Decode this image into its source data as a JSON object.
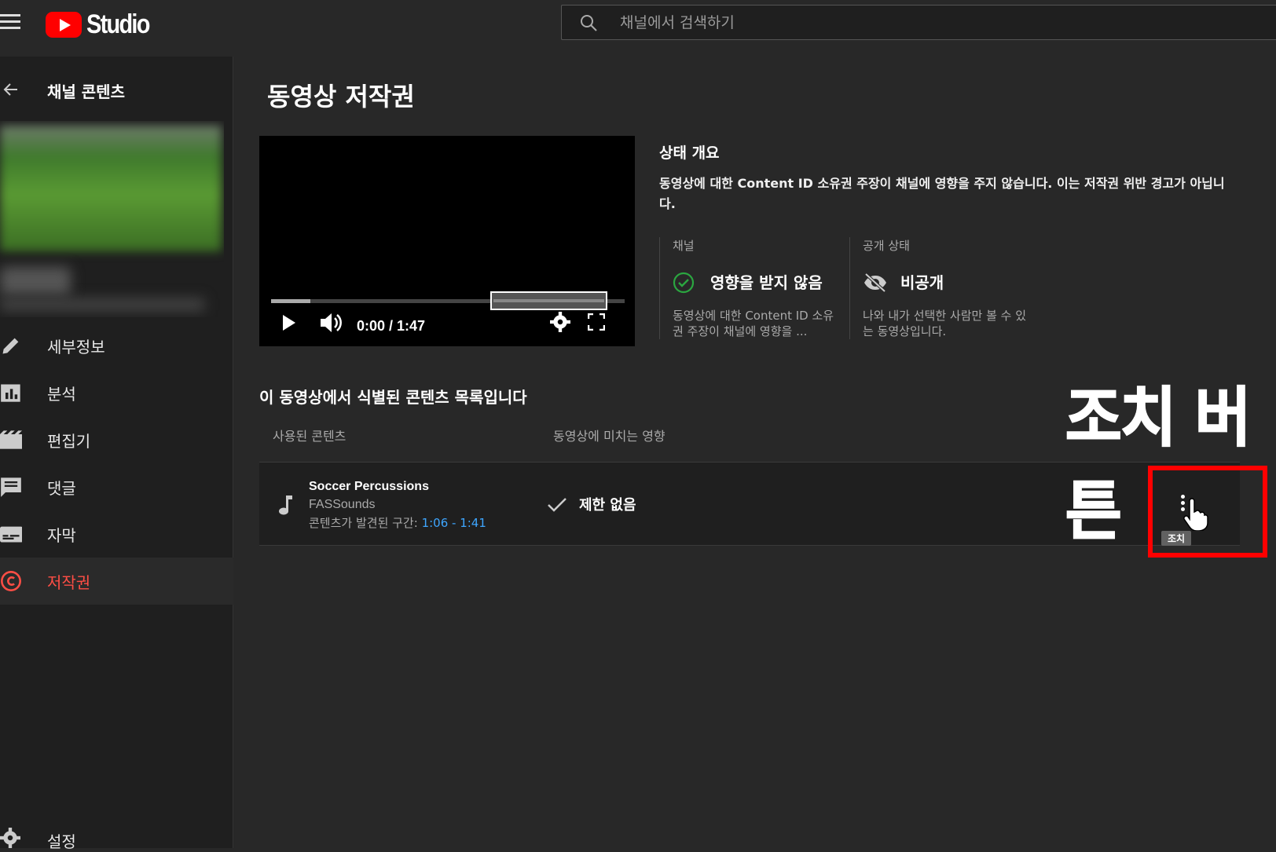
{
  "header": {
    "logo_text": "Studio",
    "search_placeholder": "채널에서 검색하기"
  },
  "sidebar": {
    "back_label": "채널 콘텐츠",
    "items": [
      {
        "label": "세부정보",
        "icon": "pencil-icon"
      },
      {
        "label": "분석",
        "icon": "analytics-icon"
      },
      {
        "label": "편집기",
        "icon": "editor-icon"
      },
      {
        "label": "댓글",
        "icon": "comments-icon"
      },
      {
        "label": "자막",
        "icon": "subtitles-icon"
      },
      {
        "label": "저작권",
        "icon": "copyright-icon",
        "active": true
      }
    ],
    "settings_label": "설정"
  },
  "main": {
    "title": "동영상 저작권",
    "player": {
      "time": "0:00 / 1:47",
      "played_fraction": 0.11,
      "segment_start_fraction": 0.62,
      "segment_end_fraction": 0.95
    },
    "status": {
      "heading": "상태 개요",
      "description": "동영상에 대한 Content ID 소유권 주장이 채널에 영향을 주지 않습니다. 이는 저작권 위반 경고가 아닙니다.",
      "channel": {
        "label": "채널",
        "value": "영향을 받지 않음",
        "detail": "동영상에 대한 Content ID 소유권 주장이 채널에 영향을 ..."
      },
      "visibility": {
        "label": "공개 상태",
        "value": "비공개",
        "detail": "나와 내가 선택한 사람만 볼 수 있는 동영상입니다."
      }
    },
    "list": {
      "title": "이 동영상에서 식별된 콘텐츠 목록입니다",
      "columns": [
        "사용된 콘텐츠",
        "동영상에 미치는 영향"
      ],
      "rows": [
        {
          "name": "Soccer Percussions",
          "artist": "FASSounds",
          "found_prefix": "콘텐츠가 발견된 구간: ",
          "found_range": "1:06 - 1:41",
          "effect": "제한 없음",
          "action_tooltip": "조치"
        }
      ]
    },
    "annotation": {
      "label": "조치 버튼",
      "highlight_color": "#ff0000"
    }
  },
  "colors": {
    "accent": "#ff4e45",
    "link": "#3ea6ff",
    "check_green": "#2ba640"
  }
}
